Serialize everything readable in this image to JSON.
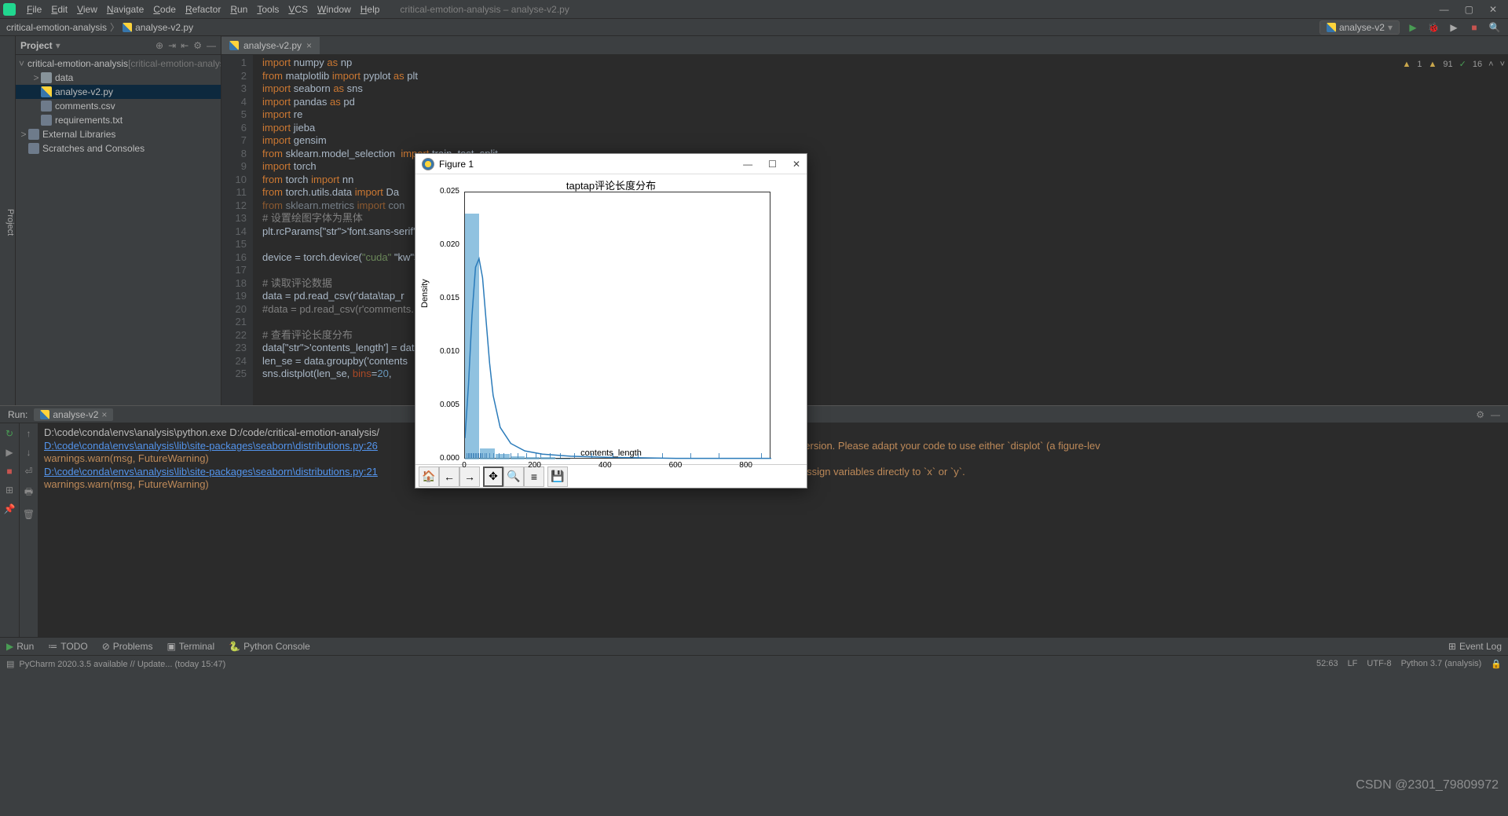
{
  "window": {
    "title": "critical-emotion-analysis – analyse-v2.py",
    "menus": [
      "File",
      "Edit",
      "View",
      "Navigate",
      "Code",
      "Refactor",
      "Run",
      "Tools",
      "VCS",
      "Window",
      "Help"
    ]
  },
  "breadcrumb": {
    "root": "critical-emotion-analysis",
    "file": "analyse-v2.py"
  },
  "run_config": {
    "name": "analyse-v2"
  },
  "project_panel": {
    "title": "Project",
    "tree": {
      "root": "critical-emotion-analysis",
      "root_hint": "[critical-emotion-analysis]",
      "children": [
        {
          "type": "folder",
          "name": "data"
        },
        {
          "type": "py",
          "name": "analyse-v2.py",
          "selected": true
        },
        {
          "type": "file",
          "name": "comments.csv"
        },
        {
          "type": "file",
          "name": "requirements.txt"
        }
      ],
      "extra": [
        "External Libraries",
        "Scratches and Consoles"
      ]
    }
  },
  "editor": {
    "tab": "analyse-v2.py",
    "lines": [
      {
        "n": 1,
        "t": "import numpy as np",
        "kind": "import"
      },
      {
        "n": 2,
        "t": "from matplotlib import pyplot as plt",
        "kind": "import"
      },
      {
        "n": 3,
        "t": "import seaborn as sns",
        "kind": "import"
      },
      {
        "n": 4,
        "t": "import pandas as pd",
        "kind": "import"
      },
      {
        "n": 5,
        "t": "import re",
        "kind": "import"
      },
      {
        "n": 6,
        "t": "import jieba",
        "kind": "import"
      },
      {
        "n": 7,
        "t": "import gensim",
        "kind": "import"
      },
      {
        "n": 8,
        "t": "from sklearn.model_selection  import train_test_split",
        "kind": "import"
      },
      {
        "n": 9,
        "t": "import torch",
        "kind": "import"
      },
      {
        "n": 10,
        "t": "from torch import nn",
        "kind": "import"
      },
      {
        "n": 11,
        "t": "from torch.utils.data import Da",
        "kind": "import"
      },
      {
        "n": 12,
        "t": "from sklearn.metrics import con",
        "kind": "import-dim"
      },
      {
        "n": 13,
        "t": "# 设置绘图字体为黑体",
        "kind": "comment"
      },
      {
        "n": 14,
        "t": "plt.rcParams['font.sans-serif']",
        "kind": "code"
      },
      {
        "n": 15,
        "t": "",
        "kind": "blank"
      },
      {
        "n": 16,
        "t": "device = torch.device(\"cuda\" if",
        "kind": "code"
      },
      {
        "n": 17,
        "t": "",
        "kind": "blank"
      },
      {
        "n": 18,
        "t": "# 读取评论数据",
        "kind": "comment"
      },
      {
        "n": 19,
        "t": "data = pd.read_csv(r'data\\tap_r",
        "kind": "code"
      },
      {
        "n": 20,
        "t": "#data = pd.read_csv(r'comments.",
        "kind": "comment"
      },
      {
        "n": 21,
        "t": "",
        "kind": "blank"
      },
      {
        "n": 22,
        "t": "# 查看评论长度分布",
        "kind": "comment"
      },
      {
        "n": 23,
        "t": "data['contents_length'] = data[",
        "kind": "code"
      },
      {
        "n": 24,
        "t": "len_se = data.groupby('contents",
        "kind": "code"
      },
      {
        "n": 25,
        "t": "sns.distplot(len_se, bins=20, ",
        "kind": "code"
      }
    ],
    "inspections": {
      "warnings": 1,
      "weak": 91,
      "typos": 16
    }
  },
  "run_panel": {
    "title": "Run:",
    "tab": "analyse-v2",
    "output": [
      {
        "type": "out",
        "text": "D:\\code\\conda\\envs\\analysis\\python.exe D:/code/critical-emotion-analysis/"
      },
      {
        "type": "link",
        "text": "D:\\code\\conda\\envs\\analysis\\lib\\site-packages\\seaborn\\distributions.py:26",
        "suffix": "future version. Please adapt your code to use either `displot` (a figure-lev"
      },
      {
        "type": "warn",
        "text": "  warnings.warn(msg, FutureWarning)"
      },
      {
        "type": "link",
        "text": "D:\\code\\conda\\envs\\analysis\\lib\\site-packages\\seaborn\\distributions.py:21",
        "suffix": "stead, assign variables directly to `x` or `y`."
      },
      {
        "type": "warn",
        "text": "  warnings.warn(msg, FutureWarning)"
      }
    ]
  },
  "bottom_toolbar": {
    "items": [
      "Run",
      "TODO",
      "Problems",
      "Terminal",
      "Python Console"
    ],
    "event_log": "Event Log"
  },
  "status_bar": {
    "left": "PyCharm 2020.3.5 available // Update... (today 15:47)",
    "right": [
      "52:63",
      "LF",
      "UTF-8",
      "Python 3.7 (analysis)"
    ]
  },
  "figure": {
    "title": "Figure 1",
    "toolbar": [
      "home",
      "back",
      "forward",
      "pan",
      "zoom",
      "subplots",
      "save"
    ]
  },
  "chart_data": {
    "type": "histogram+kde",
    "title": "taptap评论长度分布",
    "xlabel": "contents_length",
    "ylabel": "Density",
    "xlim": [
      0,
      870
    ],
    "ylim": [
      0,
      0.025
    ],
    "xticks": [
      0,
      200,
      400,
      600,
      800
    ],
    "yticks": [
      0.0,
      0.005,
      0.01,
      0.015,
      0.02,
      0.025
    ],
    "bars": [
      {
        "x0": 0,
        "x1": 43,
        "density": 0.023
      },
      {
        "x0": 43,
        "x1": 86,
        "density": 0.001
      },
      {
        "x0": 86,
        "x1": 129,
        "density": 0.0005
      },
      {
        "x0": 129,
        "x1": 172,
        "density": 0.0003
      },
      {
        "x0": 172,
        "x1": 215,
        "density": 0.0002
      },
      {
        "x0": 215,
        "x1": 258,
        "density": 0.0002
      },
      {
        "x0": 258,
        "x1": 301,
        "density": 0.0001
      }
    ],
    "kde": [
      {
        "x": 0,
        "y": 0.002
      },
      {
        "x": 10,
        "y": 0.007
      },
      {
        "x": 20,
        "y": 0.0135
      },
      {
        "x": 30,
        "y": 0.018
      },
      {
        "x": 40,
        "y": 0.0188
      },
      {
        "x": 50,
        "y": 0.017
      },
      {
        "x": 60,
        "y": 0.013
      },
      {
        "x": 70,
        "y": 0.009
      },
      {
        "x": 80,
        "y": 0.006
      },
      {
        "x": 100,
        "y": 0.003
      },
      {
        "x": 130,
        "y": 0.0015
      },
      {
        "x": 170,
        "y": 0.0008
      },
      {
        "x": 220,
        "y": 0.0005
      },
      {
        "x": 300,
        "y": 0.0003
      },
      {
        "x": 400,
        "y": 0.0002
      },
      {
        "x": 600,
        "y": 0.0001
      },
      {
        "x": 870,
        "y": 0.0001
      }
    ],
    "rug_x": [
      5,
      8,
      12,
      15,
      18,
      22,
      25,
      28,
      32,
      35,
      38,
      42,
      45,
      50,
      55,
      60,
      70,
      80,
      95,
      110,
      130,
      150,
      175,
      200,
      215,
      240,
      270,
      310,
      360,
      420,
      490,
      560,
      640,
      720,
      840
    ]
  },
  "watermark": "CSDN @2301_79809972"
}
